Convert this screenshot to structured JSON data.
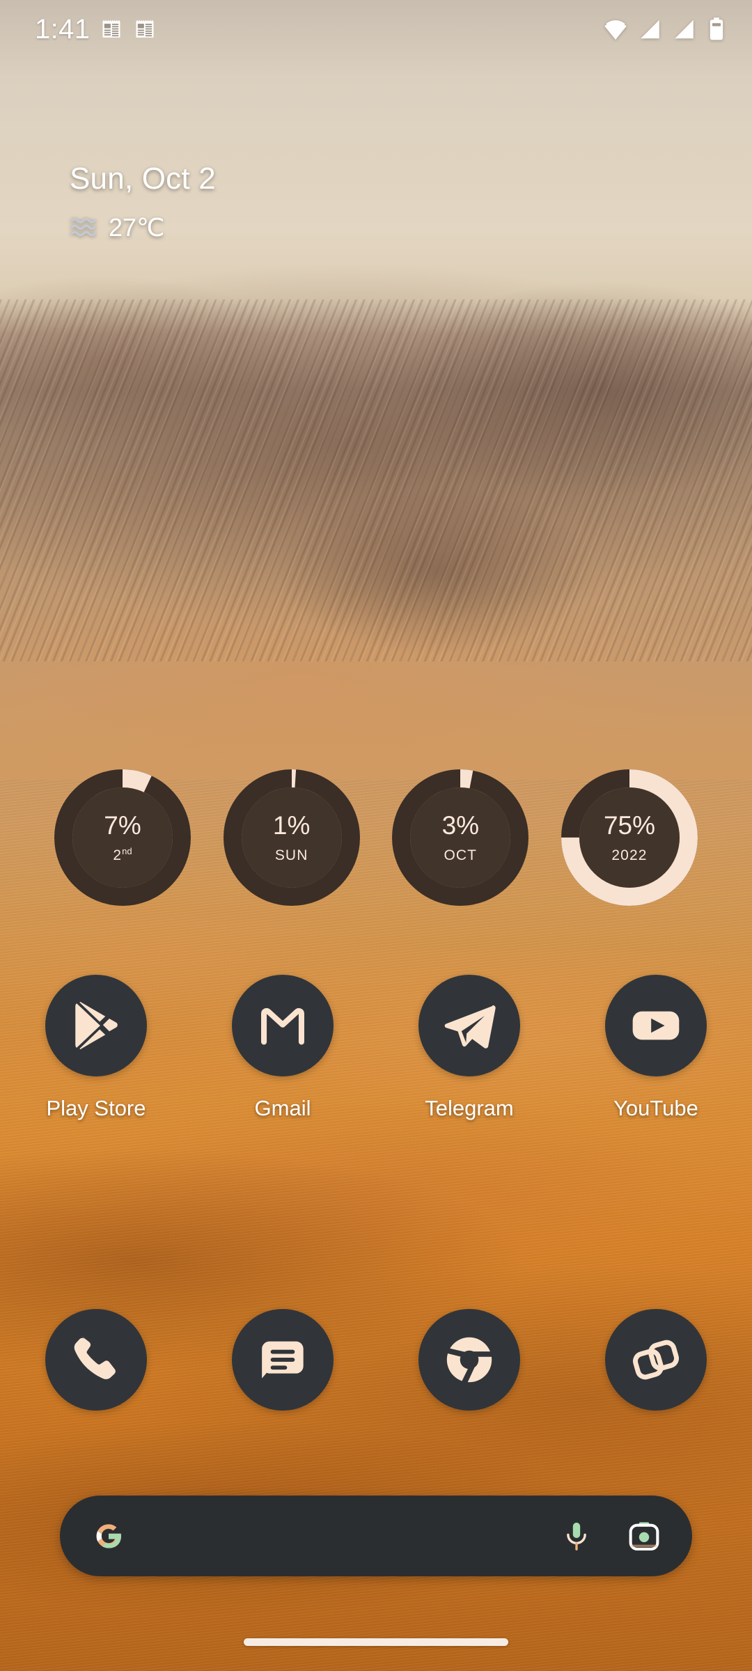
{
  "theme": {
    "icon_bg": "#31353a",
    "icon_fg": "#fbe4cf",
    "ring_track": "#3a2e26",
    "ring_face": "#41342b",
    "ring_progress": "#f8e2d2",
    "searchbar_bg": "#2b2e31",
    "text_on_wallpaper": "#ffffff"
  },
  "status_bar": {
    "clock": "1:41",
    "notification_icons": [
      {
        "name": "news-article-icon"
      },
      {
        "name": "news-article-icon"
      }
    ],
    "system_icons": [
      {
        "name": "wifi-icon"
      },
      {
        "name": "signal-bars-icon"
      },
      {
        "name": "signal-bars-icon"
      },
      {
        "name": "battery-icon"
      }
    ]
  },
  "date_widget": {
    "date": "Sun, Oct 2",
    "temperature": "27℃",
    "weather_icon": "haze-waves-icon"
  },
  "ring_widgets": [
    {
      "name": "day-progress-ring",
      "percent_label": "7%",
      "percent": 7,
      "sub_label": "2",
      "sub_suffix": "nd"
    },
    {
      "name": "week-progress-ring",
      "percent_label": "1%",
      "percent": 1,
      "sub_label": "SUN",
      "sub_suffix": ""
    },
    {
      "name": "month-progress-ring",
      "percent_label": "3%",
      "percent": 3,
      "sub_label": "OCT",
      "sub_suffix": ""
    },
    {
      "name": "year-progress-ring",
      "percent_label": "75%",
      "percent": 75,
      "sub_label": "2022",
      "sub_suffix": ""
    }
  ],
  "apps": [
    {
      "label": "Play Store",
      "icon": "play-store-icon"
    },
    {
      "label": "Gmail",
      "icon": "gmail-icon"
    },
    {
      "label": "Telegram",
      "icon": "telegram-icon"
    },
    {
      "label": "YouTube",
      "icon": "youtube-icon"
    }
  ],
  "dock": [
    {
      "label": "Phone",
      "icon": "phone-icon"
    },
    {
      "label": "Messages",
      "icon": "messages-icon"
    },
    {
      "label": "Chrome",
      "icon": "chrome-icon"
    },
    {
      "label": "Gallery",
      "icon": "gallery-icon"
    }
  ],
  "search": {
    "placeholder": "",
    "value": "",
    "logo": "google-g-logo",
    "mic_icon": "microphone-icon",
    "lens_icon": "google-lens-camera-icon"
  },
  "nav": {
    "gesture_pill": "home-gesture-pill"
  }
}
